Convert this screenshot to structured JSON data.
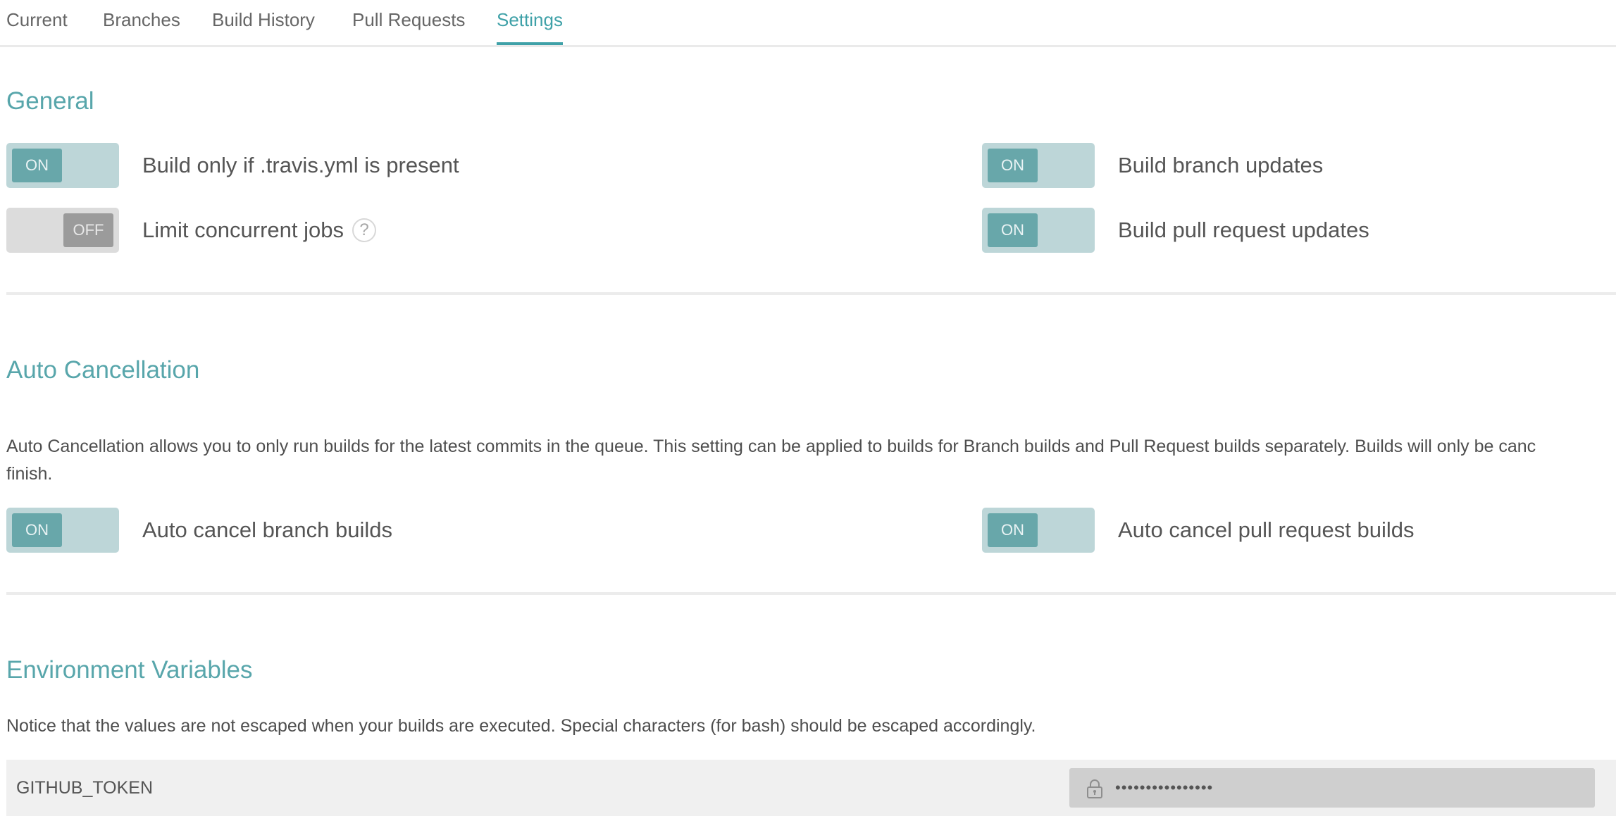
{
  "tabs": [
    {
      "label": "Current",
      "active": false
    },
    {
      "label": "Branches",
      "active": false
    },
    {
      "label": "Build History",
      "active": false
    },
    {
      "label": "Pull Requests",
      "active": false
    },
    {
      "label": "Settings",
      "active": true
    }
  ],
  "general": {
    "heading": "General",
    "settings": [
      {
        "label": "Build only if .travis.yml is present",
        "state": "ON"
      },
      {
        "label": "Build branch updates",
        "state": "ON"
      },
      {
        "label": "Limit concurrent jobs",
        "state": "OFF",
        "help_icon": "question-mark"
      },
      {
        "label": "Build pull request updates",
        "state": "ON"
      }
    ]
  },
  "auto_cancellation": {
    "heading": "Auto Cancellation",
    "description_line1": "Auto Cancellation allows you to only run builds for the latest commits in the queue. This setting can be applied to builds for Branch builds and Pull Request builds separately. Builds will only be canc",
    "description_line2": "finish.",
    "settings": [
      {
        "label": "Auto cancel branch builds",
        "state": "ON"
      },
      {
        "label": "Auto cancel pull request builds",
        "state": "ON"
      }
    ]
  },
  "environment_variables": {
    "heading": "Environment Variables",
    "notice": "Notice that the values are not escaped when your builds are executed. Special characters (for bash) should be escaped accordingly.",
    "variables": [
      {
        "name": "GITHUB_TOKEN",
        "value_masked": "••••••••••••••••",
        "icon": "lock-icon"
      }
    ]
  },
  "colors": {
    "accent": "#3fa1a8",
    "toggle_on_track": "#bdd6d8",
    "toggle_on_knob": "#68a7aa",
    "toggle_off_track": "#dcdcdc",
    "toggle_off_knob": "#9b9b9b"
  }
}
